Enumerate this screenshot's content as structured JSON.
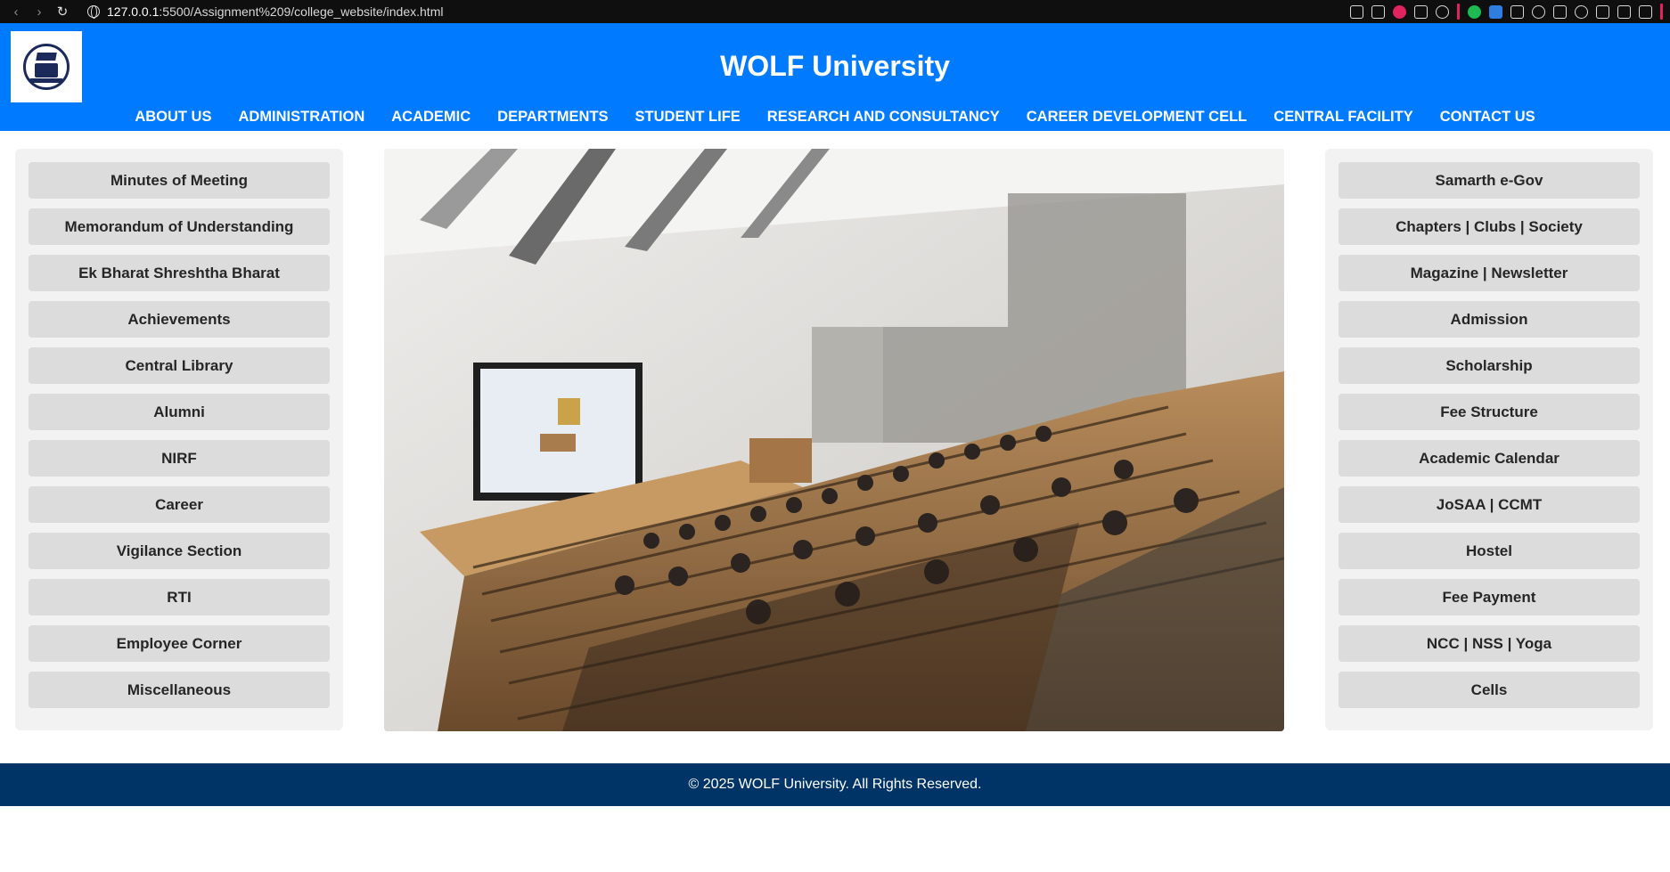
{
  "browser": {
    "url_host": "127.0.0.1",
    "url_rest": ":5500/Assignment%209/college_website/index.html"
  },
  "header": {
    "title": "WOLF University",
    "nav": [
      "ABOUT US",
      "ADMINISTRATION",
      "ACADEMIC",
      "DEPARTMENTS",
      "STUDENT LIFE",
      "RESEARCH AND CONSULTANCY",
      "CAREER DEVELOPMENT CELL",
      "CENTRAL FACILITY",
      "CONTACT US"
    ]
  },
  "left_panel": {
    "items": [
      "Minutes of Meeting",
      "Memorandum of Understanding",
      "Ek Bharat Shreshtha Bharat",
      "Achievements",
      "Central Library",
      "Alumni",
      "NIRF",
      "Career",
      "Vigilance Section",
      "RTI",
      "Employee Corner",
      "Miscellaneous"
    ]
  },
  "right_panel": {
    "items": [
      "Samarth e-Gov",
      "Chapters | Clubs | Society",
      "Magazine | Newsletter",
      "Admission",
      "Scholarship",
      "Fee Structure",
      "Academic Calendar",
      "JoSAA | CCMT",
      "Hostel",
      "Fee Payment",
      "NCC | NSS | Yoga",
      "Cells"
    ]
  },
  "footer": {
    "text": "© 2025 WOLF University. All Rights Reserved."
  },
  "colors": {
    "header_blue": "#007bff",
    "footer_navy": "#003366",
    "panel_bg": "#f2f2f2",
    "button_bg": "#dcdcdc"
  }
}
